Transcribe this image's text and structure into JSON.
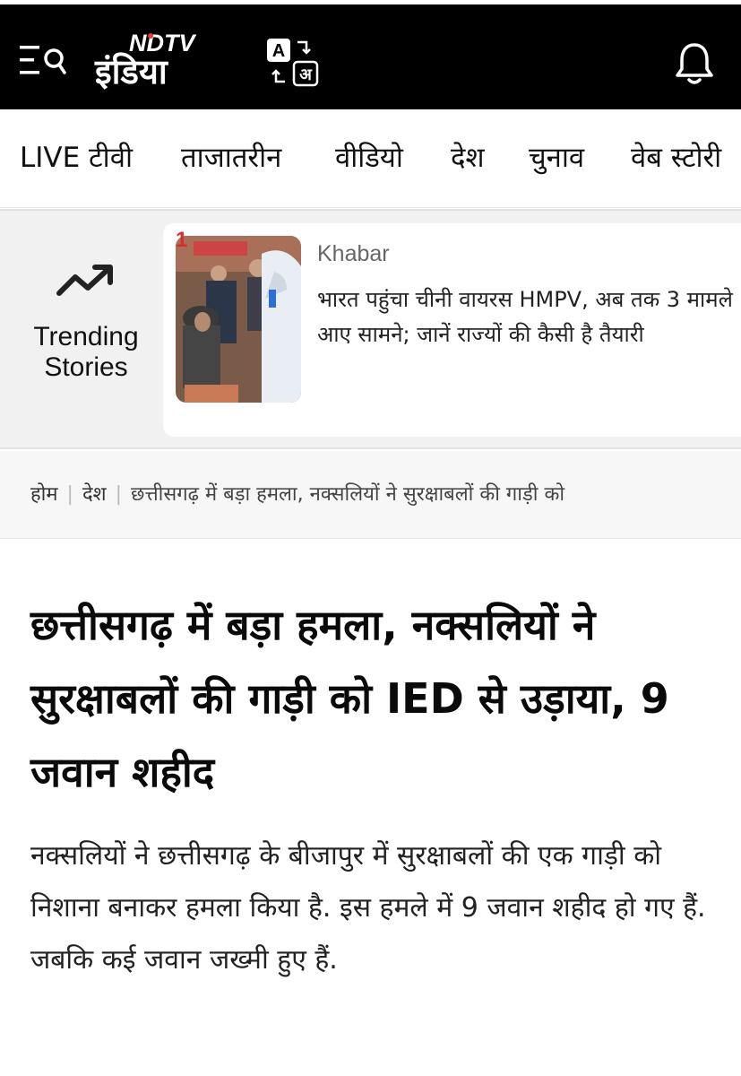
{
  "header": {
    "logo_top": "NDTV",
    "logo_bottom": "इंडिया",
    "lang_from": "A",
    "lang_to": "अ",
    "icons": [
      "menu-search-icon",
      "translate-icon",
      "bell-icon"
    ]
  },
  "nav": {
    "items": [
      "LIVE टीवी",
      "ताजातरीन",
      "वीडियो",
      "देश",
      "चुनाव",
      "वेब स्टोरी"
    ]
  },
  "trending": {
    "label": "Trending Stories",
    "icon": "trending-up-icon",
    "rank": "1",
    "source": "Khabar",
    "title": "भारत पहुंचा चीनी वायरस HMPV, अब तक 3 मामले आए सामने; जानें राज्यों की कैसी है तैयारी"
  },
  "breadcrumb": {
    "home": "होम",
    "section": "देश",
    "current": "छत्तीसगढ़ में बड़ा हमला, नक्सलियों ने सुरक्षाबलों की गाड़ी को"
  },
  "article": {
    "headline": "छत्तीसगढ़ में बड़ा हमला, नक्सलियों ने सुरक्षाबलों की गाड़ी को IED से उड़ाया, 9 जवान शहीद",
    "summary": "नक्सलियों ने छत्तीसगढ़ के बीजापुर में सुरक्षाबलों की एक गाड़ी को निशाना बनाकर हमला किया है. इस हमले में 9 जवान शहीद हो गए हैं. जबकि कई जवान जख्मी हुए हैं."
  },
  "colors": {
    "header_bg": "#000000",
    "accent_red": "#e53935",
    "trending_bg": "#f1f1f1"
  }
}
